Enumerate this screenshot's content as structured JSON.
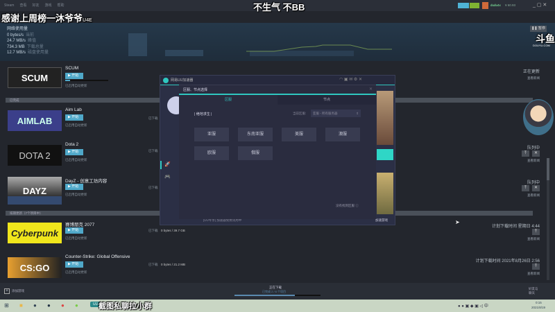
{
  "menu": [
    "Steam",
    "查看",
    "好友",
    "游戏",
    "帮助"
  ],
  "overlay": {
    "left": "感谢上周榜一沐爷爷",
    "top": "不生气 不BB",
    "suffix": "U4E",
    "logo": "斗鱼",
    "logo_sub": "DOUYU.COM"
  },
  "account": {
    "name": "dudu4x",
    "balance": "¥ 60.93"
  },
  "network": {
    "title": "网络使用量",
    "rows": [
      {
        "v": "0 bytes/s",
        "l": "当前"
      },
      {
        "v": "24.7 MB/s",
        "l": "峰值"
      },
      {
        "v": "734.3 MB",
        "l": "下载总量"
      },
      {
        "v": "12.7 MB/s",
        "l": "磁盘使用量"
      }
    ],
    "pause": "暂停"
  },
  "games": [
    {
      "name": "SCUM",
      "thumb": "SCUM",
      "play": "开始",
      "auto": "已启用自动更新",
      "status": "正在更新",
      "news": "查看新闻"
    },
    {
      "name": "Aim Lab",
      "thumb": "AIMLAB",
      "play": "开始",
      "auto": "已启用自动更新",
      "downloaded": "已下载",
      "status": "队列中",
      "news": "查看新闻"
    },
    {
      "name": "Dota 2",
      "thumb": "DOTA 2",
      "play": "开始",
      "auto": "已启用自动更新",
      "downloaded": "已下载",
      "status": "",
      "news": "查看新闻"
    },
    {
      "name": "DayZ - 创意工坊内容",
      "thumb": "DAYZ",
      "play": "开始",
      "auto": "已启用自动更新",
      "downloaded": "已下载",
      "status": "队列中",
      "news": "查看新闻"
    },
    {
      "name": "赛博朋克 2077",
      "thumb": "Cyberpunk",
      "play": "开始",
      "auto": "已启用自动更新",
      "downloaded": "已下载",
      "size": "0 bytes / 39.7 GB",
      "status": "计划下载时间 星期日 4:44",
      "news": "查看新闻"
    },
    {
      "name": "Counter-Strike: Global Offensive",
      "thumb": "CS:GO",
      "play": "开始",
      "auto": "已启用自动更新",
      "downloaded": "已下载",
      "size": "0 bytes / 21.2 MB",
      "status": "计划下载时间 2021年8月26日 2:56",
      "news": "查看新闻"
    }
  ],
  "sections": [
    "已完成",
    "排期更新（7个项目中）"
  ],
  "accelerator": {
    "title": "网易UU加速器",
    "modal_title": "区服、节点选择",
    "tabs": [
      "区服",
      "节点"
    ],
    "game": "| 绝地求生 |",
    "current_label": "当前区服:",
    "current_value": "亚服 - 所有服务器",
    "regions": [
      "亚服",
      "东南亚服",
      "美服",
      "澳服",
      "欧服",
      "俄服"
    ],
    "help": "没有找到区服",
    "footer_left": "[UU专享] 加速器免费试用中",
    "footer_right": "加速游戏"
  },
  "bottom": {
    "add": "添加游戏",
    "status": "正在下载",
    "sub": "已完成 2 / 6 个项目",
    "friends": "好友与聊天"
  },
  "taskbar": {
    "chip": "截图私聊拉小群",
    "time": "0:15",
    "date": "2021/8/19"
  }
}
